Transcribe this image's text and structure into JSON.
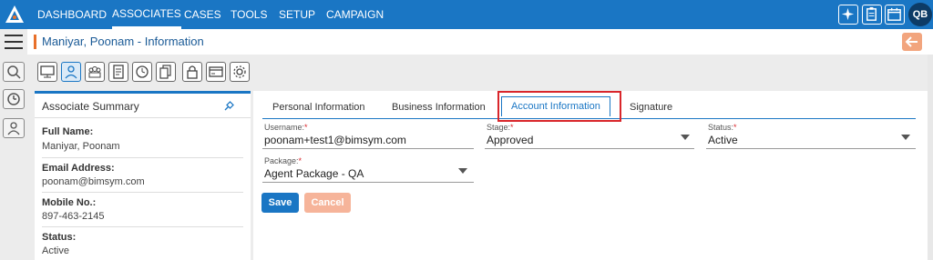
{
  "nav": {
    "items": [
      {
        "label": "DASHBOARD",
        "active": false
      },
      {
        "label": "ASSOCIATES",
        "active": true
      },
      {
        "label": "CASES",
        "active": false
      },
      {
        "label": "TOOLS",
        "active": false
      },
      {
        "label": "SETUP",
        "active": false
      },
      {
        "label": "CAMPAIGN",
        "active": false
      }
    ],
    "icons": [
      "sparkle-icon",
      "clipboard-icon",
      "calendar-icon"
    ],
    "avatar_initials": "QB",
    "brand_color": "#1a76c4"
  },
  "header": {
    "title": "Maniyar, Poonam - Information",
    "back_icon": "arrow-left-icon"
  },
  "toolbar": {
    "icons": [
      "monitor-icon",
      "user-icon",
      "group-icon",
      "document-icon",
      "clock-icon",
      "files-icon",
      "lock-icon",
      "card-icon",
      "gear-icon"
    ],
    "active_index": 1
  },
  "rail": {
    "icons": [
      "menu-icon",
      "search-icon",
      "history-icon",
      "contacts-icon"
    ]
  },
  "summary": {
    "title": "Associate Summary",
    "fields": [
      {
        "label": "Full Name:",
        "value": "Maniyar, Poonam"
      },
      {
        "label": "Email Address:",
        "value": "poonam@bimsym.com"
      },
      {
        "label": "Mobile No.:",
        "value": "897-463-2145"
      },
      {
        "label": "Status:",
        "value": "Active"
      }
    ]
  },
  "tabs": [
    {
      "label": "Personal Information",
      "active": false
    },
    {
      "label": "Business Information",
      "active": false
    },
    {
      "label": "Account Information",
      "active": true
    },
    {
      "label": "Signature",
      "active": false
    }
  ],
  "form": {
    "username": {
      "label": "Username:",
      "value": "poonam+test1@bimsym.com"
    },
    "stage": {
      "label": "Stage:",
      "value": "Approved"
    },
    "status": {
      "label": "Status:",
      "value": "Active"
    },
    "package": {
      "label": "Package:",
      "value": "Agent Package - QA"
    },
    "required_marker": "*"
  },
  "buttons": {
    "save": "Save",
    "cancel": "Cancel"
  }
}
